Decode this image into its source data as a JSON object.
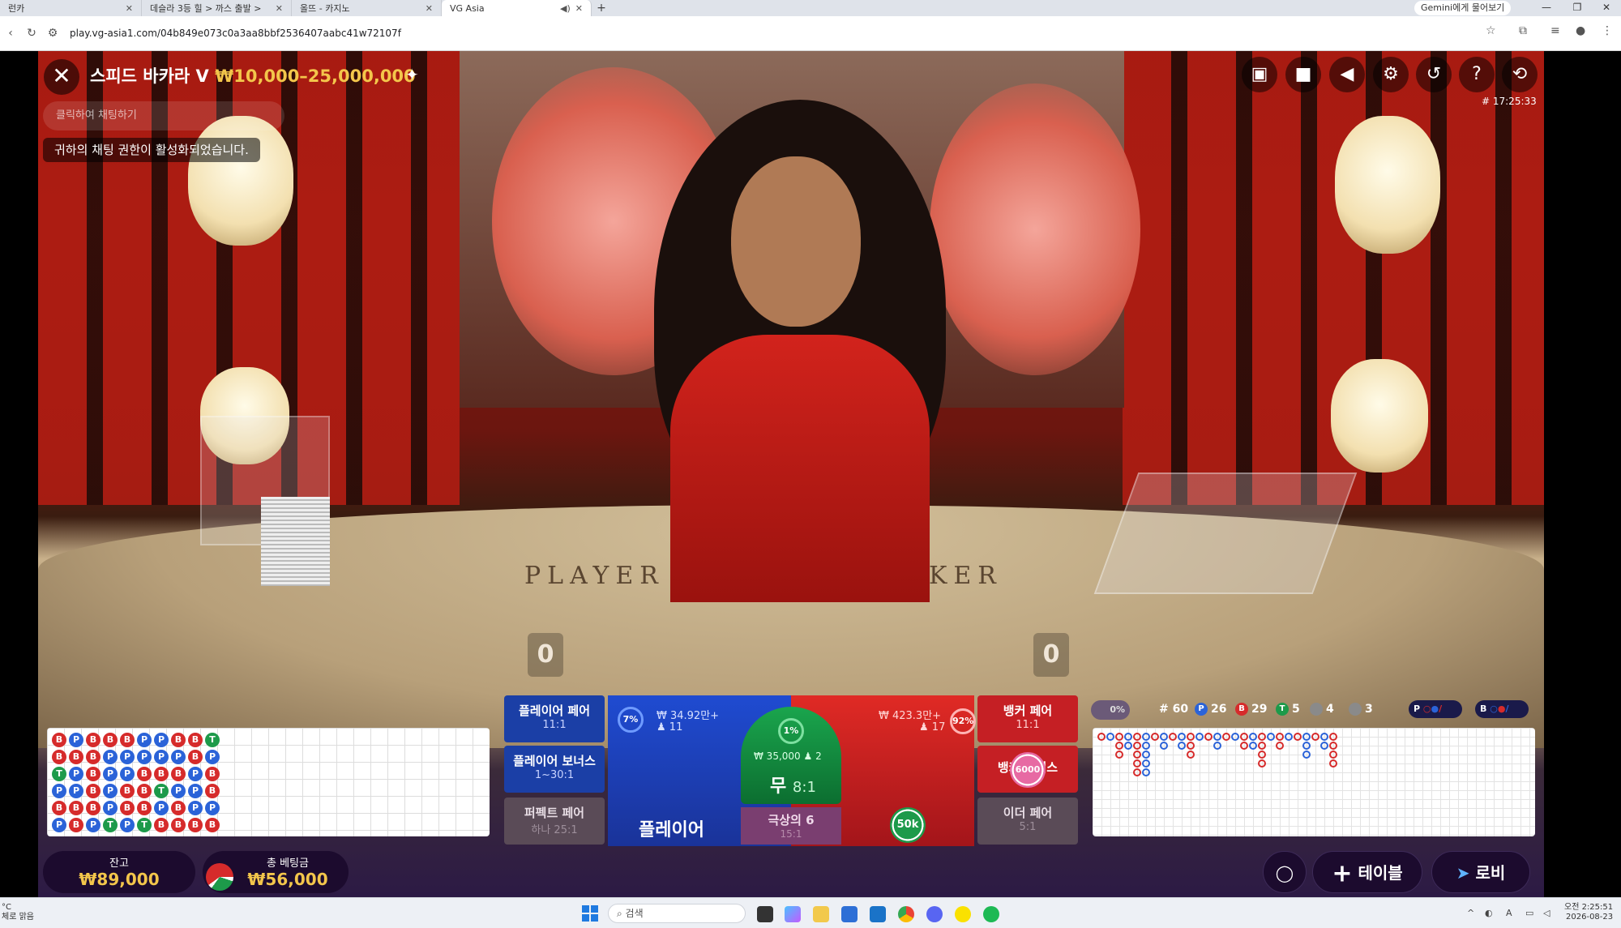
{
  "browser": {
    "tabs": [
      {
        "title": "런카",
        "active": false
      },
      {
        "title": "데슬라 3등 힐 > 까스 출발 >",
        "active": false
      },
      {
        "title": "올뜨 - 카지노",
        "active": false
      },
      {
        "title": "VG Asia",
        "active": true
      }
    ],
    "gemini_label": "Gemini에게 물어보기",
    "url": "play.vg-asia1.com/04b849e073c0a3aa8bbf2536407aabc41w72107f"
  },
  "game": {
    "title": "스피드 바카라 V",
    "limit": "₩10,000–25,000,000",
    "chat_placeholder": "클릭하여 채팅하기",
    "chat_notice": "귀하의 채팅 권한이 활성화되었습니다.",
    "round_id": "# 17:25:33",
    "table_text_player": "PLAYER",
    "table_text_banker": "BANKER",
    "player_score": "0",
    "banker_score": "0"
  },
  "bets": {
    "player_pair": {
      "label": "플레이어 페어",
      "odds": "11:1"
    },
    "player_bonus": {
      "label": "플레이어 보너스",
      "odds": "1~30:1"
    },
    "perfect_pair": {
      "label": "퍼펙트 페어",
      "odds": "하나 25:1"
    },
    "banker_pair": {
      "label": "뱅커 페어",
      "odds": "11:1"
    },
    "banker_bonus": {
      "label": "뱅커 보너스",
      "chip": "6000"
    },
    "either_pair": {
      "label": "이더 페어",
      "odds": "5:1"
    },
    "player": {
      "label": "플레이어",
      "pct": "7%",
      "amount": "₩ 34.92만+",
      "players": "11"
    },
    "banker": {
      "pct": "92%",
      "amount": "₩ 423.3만+",
      "players": "17",
      "chip": "50k"
    },
    "tie": {
      "label": "무",
      "odds": "8:1",
      "pct": "1%",
      "amount": "₩ 35,000",
      "players": "2"
    },
    "super_six": {
      "label": "극상의 6",
      "odds": "15:1"
    }
  },
  "stats": {
    "percent": "0%",
    "rounds": "# 60",
    "player_wins": "26",
    "banker_wins": "29",
    "ties": "5",
    "player_pairs": "4",
    "banker_pairs": "3",
    "p_label": "P",
    "b_label": "B",
    "t_label": "T"
  },
  "bead_road": [
    [
      "B",
      "P",
      "B",
      "B",
      "B",
      "P",
      "P",
      "B",
      "B",
      "T"
    ],
    [
      "B",
      "B",
      "B",
      "P",
      "P",
      "P",
      "P",
      "P",
      "B",
      "P"
    ],
    [
      "T",
      "P",
      "B",
      "P",
      "P",
      "B",
      "B",
      "B",
      "P",
      "B"
    ],
    [
      "P",
      "P",
      "B",
      "P",
      "B",
      "B",
      "T",
      "P",
      "P",
      "B"
    ],
    [
      "B",
      "B",
      "B",
      "P",
      "B",
      "B",
      "P",
      "B",
      "P",
      "P"
    ],
    [
      "P",
      "B",
      "P",
      "T",
      "P",
      "T",
      "B",
      "B",
      "B",
      "B"
    ]
  ],
  "footer": {
    "balance_label": "잔고",
    "balance_value": "₩89,000",
    "total_bet_label": "총 베팅금",
    "total_bet_value": "₩56,000",
    "add_table": "테이블",
    "lobby": "로비"
  },
  "taskbar": {
    "weather_1": "°C",
    "weather_2": "체로 맑음",
    "search": "검색",
    "time": "오전 2:25:51",
    "date": "2026-08-23"
  },
  "colors": {
    "accent_gold": "#f3c64b",
    "player_blue": "#2b63d8",
    "banker_red": "#d62b2b",
    "tie_green": "#1d9a4a"
  }
}
